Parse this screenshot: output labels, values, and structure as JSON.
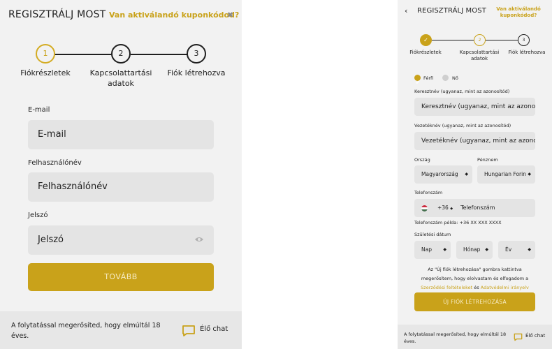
{
  "colors": {
    "accent": "#c9a21a",
    "panel_bg": "#f2f2f2",
    "input_bg": "#e4e4e4",
    "footer_bg": "#e7e7e7"
  },
  "left": {
    "header": {
      "title": "REGISZTRÁLJ MOST",
      "coupon_link": "Van aktiválandó kuponkódod?",
      "close_icon": "close-icon"
    },
    "steps": [
      {
        "number": "1",
        "label": "Fiókrészletek",
        "state": "active"
      },
      {
        "number": "2",
        "label_line1": "Kapcsolattartási",
        "label_line2": "adatok",
        "state": "pending"
      },
      {
        "number": "3",
        "label": "Fiók létrehozva",
        "state": "pending"
      }
    ],
    "fields": {
      "email": {
        "label": "E-mail",
        "placeholder": "E-mail"
      },
      "username": {
        "label": "Felhasználónév",
        "placeholder": "Felhasználónév"
      },
      "password": {
        "label": "Jelszó",
        "placeholder": "Jelszó",
        "icon": "eye-icon"
      }
    },
    "next_button": "TOVÁBB",
    "footer": {
      "text": "A folytatással megerősíted, hogy elmúltál 18 éves.",
      "chat_icon": "chat-icon",
      "chat_label": "Élő chat"
    }
  },
  "right": {
    "header": {
      "back_icon": "chevron-left-icon",
      "title": "REGISZTRÁLJ MOST",
      "coupon_line1": "Van aktiválandó",
      "coupon_line2": "kuponkódod?"
    },
    "steps": [
      {
        "number": "✓",
        "label": "Fiókrészletek",
        "state": "done"
      },
      {
        "number": "2",
        "label_line1": "Kapcsolattartási",
        "label_line2": "adatok",
        "state": "active"
      },
      {
        "number": "3",
        "label": "Fiók létrehozva",
        "state": "pending"
      }
    ],
    "gender": {
      "male": "Férfi",
      "female": "Nő",
      "selected": "male"
    },
    "fields": {
      "first_name": {
        "label": "Keresztnév (ugyanaz, mint az azonosítód)",
        "placeholder": "Keresztnév (ugyanaz, mint az azonosítód)"
      },
      "last_name": {
        "label": "Vezetéknév (ugyanaz, mint az azonosítód)",
        "placeholder": "Vezetéknév (ugyanaz, mint az azonosítód)"
      },
      "country": {
        "label": "Ország",
        "value": "Magyarország"
      },
      "currency": {
        "label": "Pénznem",
        "value": "Hungarian Forint"
      },
      "phone": {
        "label": "Telefonszám",
        "prefix": "+36",
        "placeholder": "Telefonszám",
        "example": "Telefonszám példa: +36 XX XXX XXXX",
        "flag_icon": "hungary-flag-icon"
      },
      "birthdate": {
        "label": "Születési dátum",
        "day": "Nap",
        "month": "Hónap",
        "year": "Év"
      }
    },
    "consent": {
      "line1": "Az \"Új fiók létrehozása\" gombra kattintva",
      "line2": "megerősítem, hogy elolvastam és elfogadom a",
      "terms_link": "Szerződési feltételeket",
      "and": "és",
      "privacy_link": "Adatvédelmi irányelv"
    },
    "create_button": "ÚJ FIÓK LÉTREHOZÁSA",
    "footer": {
      "text": "A folytatással megerősíted, hogy elmúltál 18 éves.",
      "chat_icon": "chat-icon",
      "chat_label": "Élő chat"
    }
  }
}
